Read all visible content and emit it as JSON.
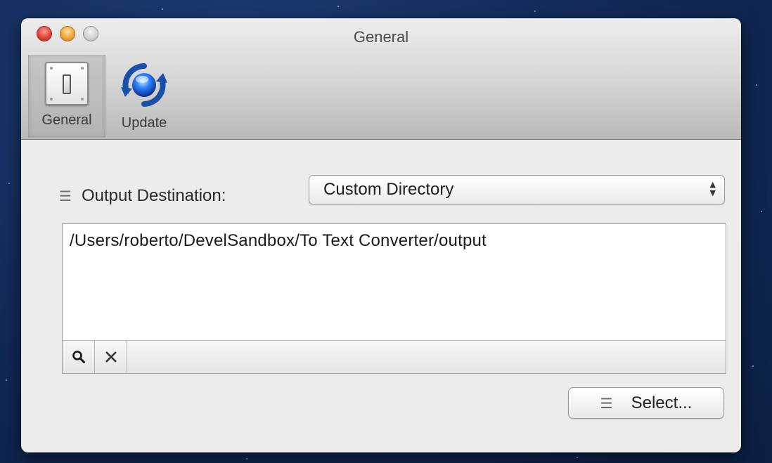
{
  "window": {
    "title": "General"
  },
  "toolbar": {
    "items": [
      {
        "label": "General",
        "icon": "switch-icon",
        "selected": true
      },
      {
        "label": "Update",
        "icon": "update-icon",
        "selected": false
      }
    ]
  },
  "main": {
    "output_destination_label": "Output Destination:",
    "output_destination_value": "Custom Directory",
    "path_value": "/Users/roberto/DevelSandbox/To Text Converter/output",
    "reveal_icon": "magnifier-icon",
    "clear_icon": "close-icon",
    "select_button_label": "Select..."
  },
  "colors": {
    "close": "#e0443a",
    "minimize": "#f0a73a",
    "zoom": "#cfcfcf",
    "update_icon_blue": "#2a7fff"
  }
}
